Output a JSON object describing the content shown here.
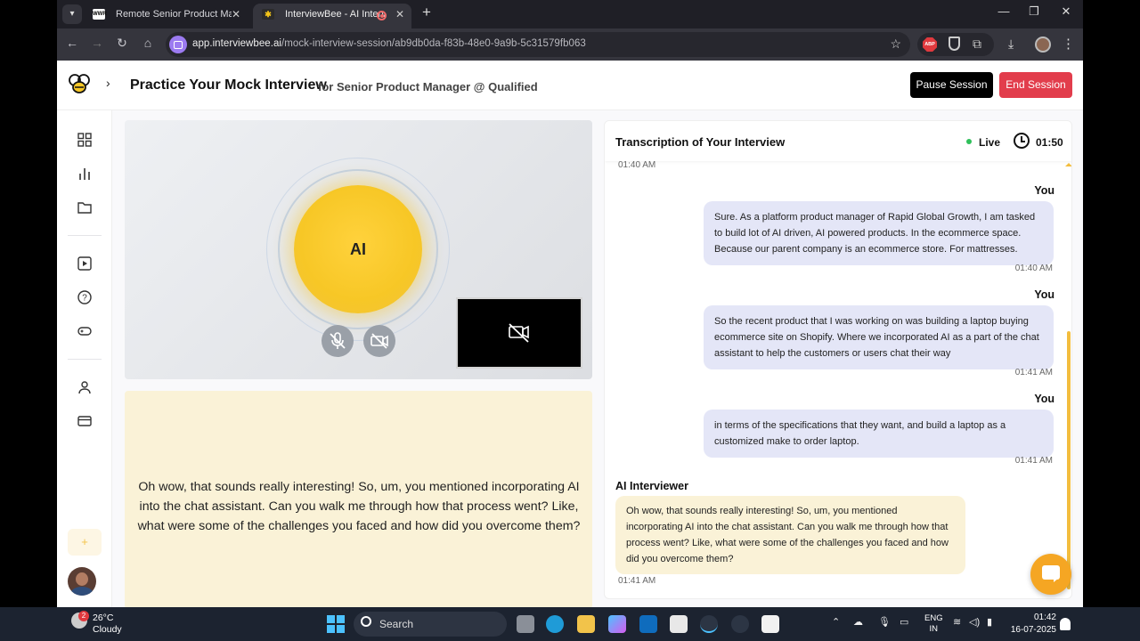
{
  "browser": {
    "tabs": [
      {
        "title": "Remote Senior Product Manager",
        "favicon": "wwr-favicon"
      },
      {
        "title": "InterviewBee - AI Interview",
        "favicon": "bee-favicon",
        "recording": true
      }
    ],
    "url_host": "app.interviewbee.ai",
    "url_path": "/mock-interview-session/ab9db0da-f83b-48e0-9a9b-5c31579fb063",
    "extension_abp": "ABP"
  },
  "app": {
    "title": "Practice Your Mock Interview",
    "subtitle": "for Senior Product Manager @ Qualified",
    "pause_label": "Pause Session",
    "end_label": "End Session",
    "sidebar_icons": [
      "dashboard-icon",
      "chart-icon",
      "folder-icon",
      "play-icon",
      "help-icon",
      "gamepad-icon",
      "user-icon",
      "credit-card-icon"
    ],
    "add_label": "+"
  },
  "video": {
    "ai_label": "AI"
  },
  "question": "Oh wow, that sounds really interesting! So, um, you mentioned incorporating AI into the chat assistant. Can you walk me through how that process went? Like, what were some of the challenges you faced and how did you overcome them?",
  "transcript": {
    "title": "Transcription of Your Interview",
    "live_label": "Live",
    "timer": "01:50",
    "top_time": "01:40 AM",
    "messages": [
      {
        "speaker": "You",
        "text": "Sure. As a platform product manager of Rapid Global Growth, I am tasked to build lot of AI driven, AI powered products. In the ecommerce space. Because our parent company is an ecommerce store. For mattresses.",
        "time": "01:40 AM"
      },
      {
        "speaker": "You",
        "text": "So the recent product that I was working on was building a laptop buying ecommerce site on Shopify. Where we incorporated AI as a part of the chat assistant to help the customers or users chat their way",
        "time": "01:41 AM"
      },
      {
        "speaker": "You",
        "text": "in terms of the specifications that they want, and build a laptop as a customized make to order laptop.",
        "time": "01:41 AM"
      },
      {
        "speaker": "AI Interviewer",
        "text": "Oh wow, that sounds really interesting! So, um, you mentioned incorporating AI into the chat assistant. Can you walk me through how that process went? Like, what were some of the challenges you faced and how did you overcome them?",
        "time": "01:41 AM"
      }
    ]
  },
  "taskbar": {
    "weather_badge": "2",
    "temperature": "26°C",
    "condition": "Cloudy",
    "search_label": "Search",
    "lang_1": "ENG",
    "lang_2": "IN",
    "time": "01:42",
    "date": "16-07-2025"
  },
  "colors": {
    "accent_yellow": "#f7c726",
    "end_red": "#e23d4c",
    "user_bubble": "#e4e6f7",
    "ai_bubble": "#faf2d7",
    "live_green": "#2fc05a"
  }
}
